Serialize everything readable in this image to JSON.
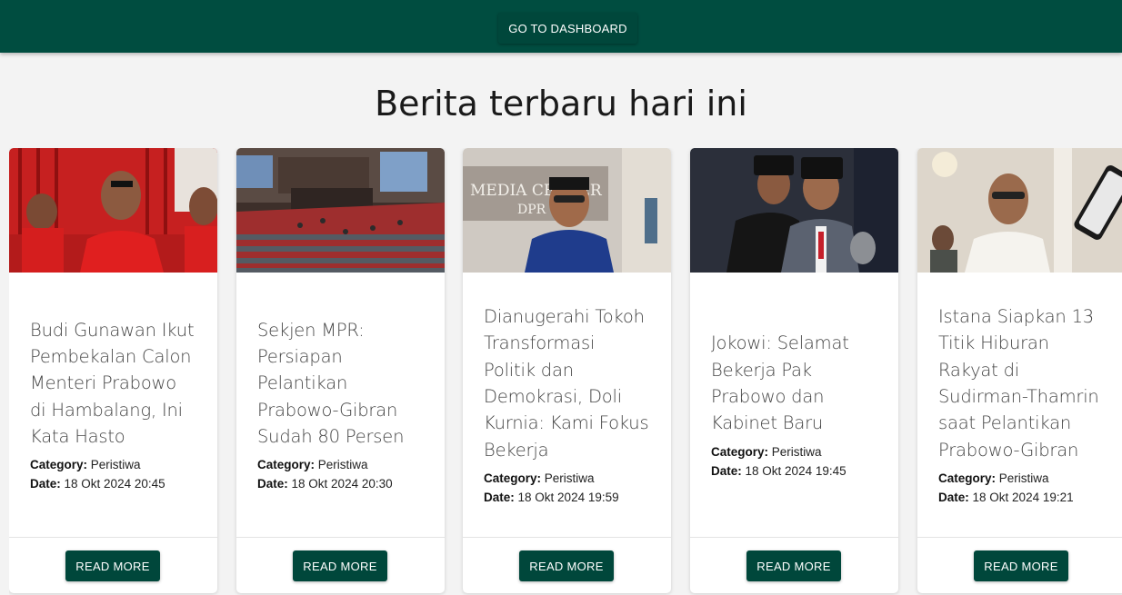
{
  "header": {
    "dashboard_label": "GO TO DASHBOARD"
  },
  "main": {
    "heading": "Berita terbaru hari ini"
  },
  "labels": {
    "category": "Category:",
    "date": "Date:",
    "read_more": "READ MORE"
  },
  "articles": [
    {
      "title": "Budi Gunawan Ikut Pembekalan Calon Menteri Prabowo di Hambalang, Ini Kata Hasto",
      "category": "Peristiwa",
      "date": "18 Okt 2024 20:45",
      "image": "party-officials-photo"
    },
    {
      "title": "Sekjen MPR: Persiapan Pelantikan Prabowo-Gibran Sudah 80 Persen",
      "category": "Peristiwa",
      "date": "18 Okt 2024 20:30",
      "image": "parliament-hall-photo"
    },
    {
      "title": "Dianugerahi Tokoh Transformasi Politik dan Demokrasi, Doli Kurnia: Kami Fokus Bekerja",
      "category": "Peristiwa",
      "date": "18 Okt 2024 19:59",
      "image": "media-center-photo"
    },
    {
      "title": "Jokowi: Selamat Bekerja Pak Prabowo dan Kabinet Baru",
      "category": "Peristiwa",
      "date": "18 Okt 2024 19:45",
      "image": "leaders-meeting-photo"
    },
    {
      "title": "Istana Siapkan 13 Titik Hiburan Rakyat di Sudirman-Thamrin saat Pelantikan Prabowo-Gibran",
      "category": "Peristiwa",
      "date": "18 Okt 2024 19:21",
      "image": "palace-interview-photo"
    }
  ],
  "image_labels": {
    "media_center": "MEDIA CENTER",
    "dpr": "DPR"
  },
  "colors": {
    "header_bg": "#004d40",
    "button_bg": "#00473b",
    "page_bg": "#f3f3f3"
  }
}
